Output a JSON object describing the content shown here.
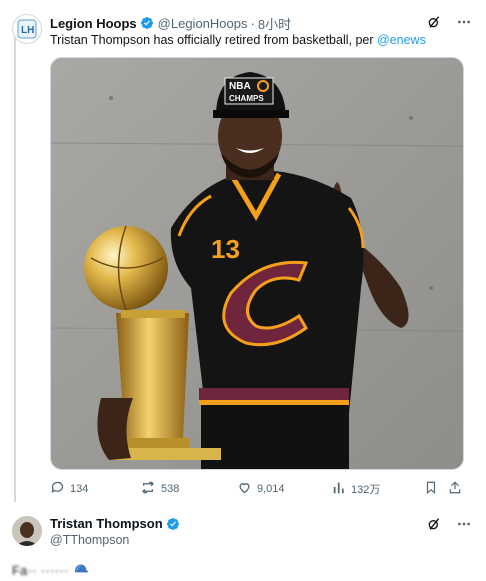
{
  "tweet": {
    "author_name": "Legion Hoops",
    "author_handle": "@LegionHoops",
    "separator": "·",
    "time": "8小时",
    "text_before": "Tristan Thompson has officially retired from basketball, per ",
    "mention": "@enews",
    "stats": {
      "replies": "134",
      "retweets": "538",
      "likes": "9,014",
      "views": "132万"
    },
    "image": {
      "cap_text_top": "NBA",
      "cap_text_bottom": "CHAMPS",
      "jersey_number": "13"
    }
  },
  "reply": {
    "author_name": "Tristan Thompson",
    "author_handle": "@TThompson",
    "text": "Fa·· ······"
  },
  "colors": {
    "accent": "#1d9bf0",
    "text": "#0f1419",
    "secondary": "#536471",
    "border": "#cfd9de",
    "cavs_wine": "#6f263d",
    "cavs_gold": "#f6a01a"
  },
  "icons": [
    "verified-badge-icon",
    "grok-icon",
    "more-icon",
    "reply-icon",
    "retweet-icon",
    "like-icon",
    "views-icon",
    "bookmark-icon",
    "share-icon",
    "cap-emoji-icon"
  ]
}
